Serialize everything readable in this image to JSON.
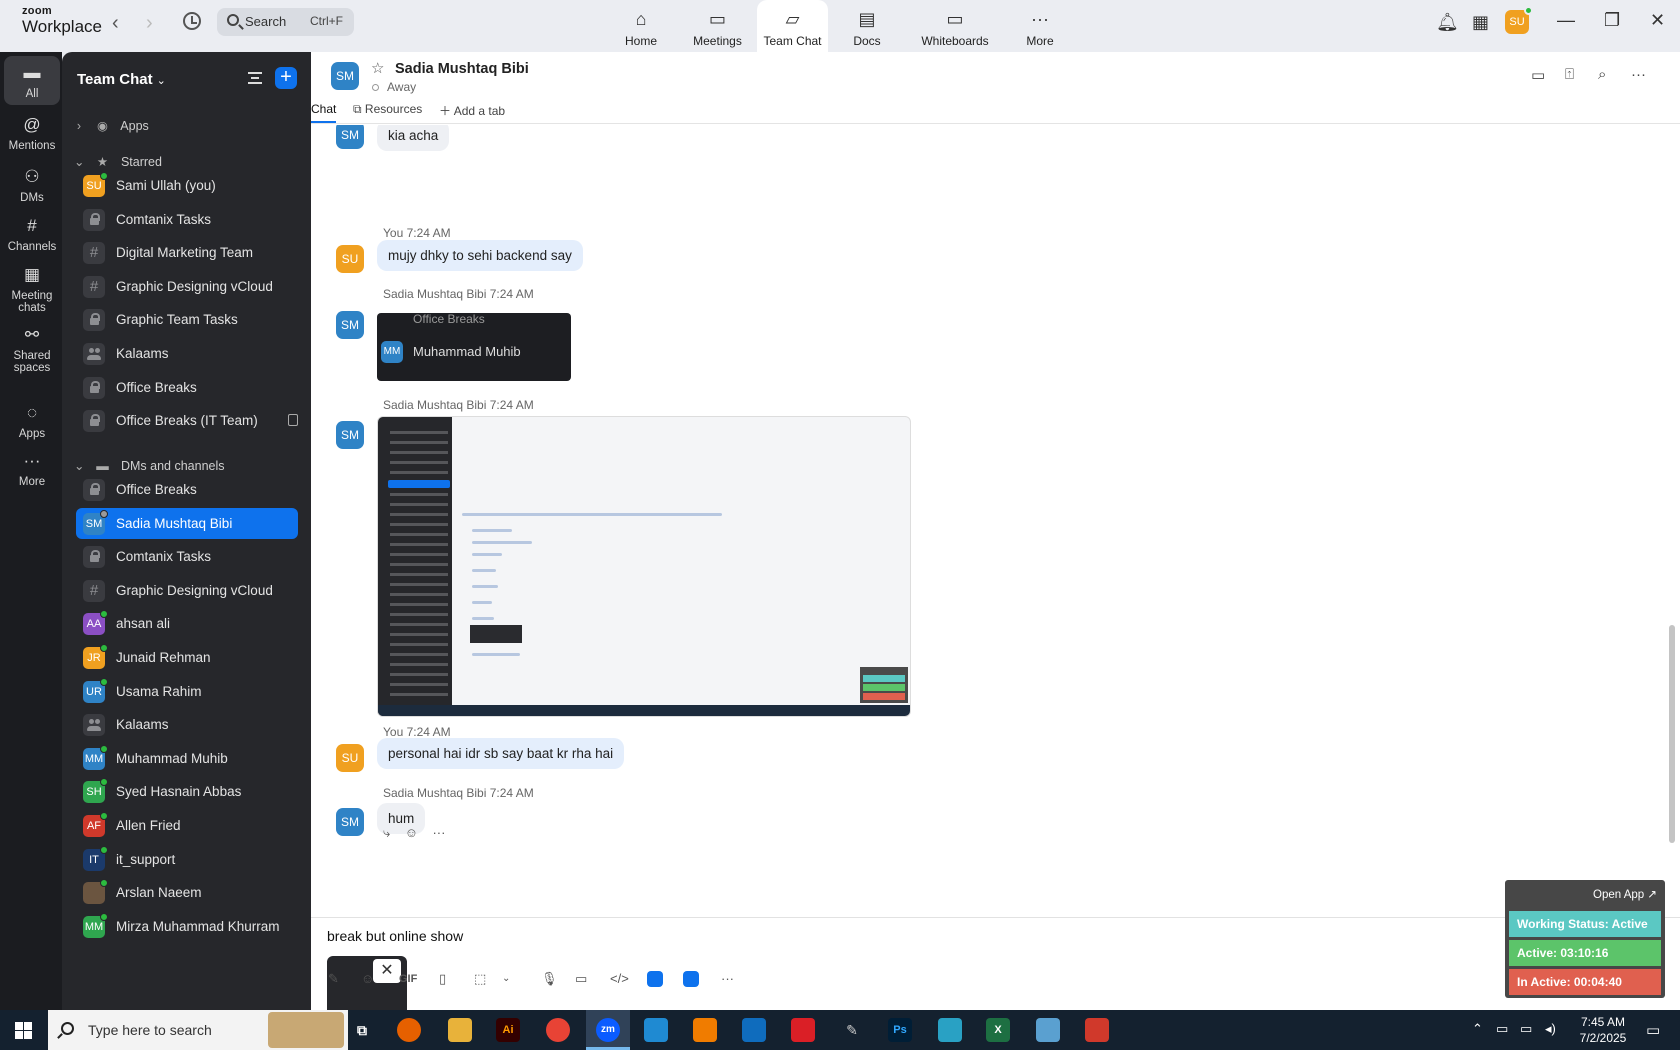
{
  "app": {
    "logo_line1": "zoom",
    "logo_line2": "Workplace",
    "search_label": "Search",
    "search_shortcut": "Ctrl+F",
    "avatar_initials": "SU"
  },
  "topnav": [
    {
      "label": "Home",
      "icon": "home-icon",
      "glyph": "⌂"
    },
    {
      "label": "Meetings",
      "icon": "video-icon",
      "glyph": "▭"
    },
    {
      "label": "Team Chat",
      "icon": "chat-icon",
      "glyph": "💬"
    },
    {
      "label": "Docs",
      "icon": "doc-icon",
      "glyph": "▤"
    },
    {
      "label": "Whiteboards",
      "icon": "whiteboard-icon",
      "glyph": "▭"
    },
    {
      "label": "More",
      "icon": "more-icon",
      "glyph": "···"
    }
  ],
  "rail": [
    {
      "label": "All",
      "icon": "chat-icon",
      "glyph": "▬"
    },
    {
      "label": "Mentions",
      "icon": "at-icon",
      "glyph": "@"
    },
    {
      "label": "DMs",
      "icon": "people-icon",
      "glyph": "👥"
    },
    {
      "label": "Channels",
      "icon": "hash-icon",
      "glyph": "#"
    },
    {
      "label": "Meeting chats",
      "icon": "calendar-icon",
      "glyph": "▦"
    },
    {
      "label": "Shared spaces",
      "icon": "share-icon",
      "glyph": "⚯"
    },
    {
      "label": "Apps",
      "icon": "apps-icon",
      "glyph": "💬"
    },
    {
      "label": "More",
      "icon": "more-icon",
      "glyph": "···"
    }
  ],
  "sidebar": {
    "title": "Team Chat",
    "sections": {
      "apps": "Apps",
      "starred": "Starred",
      "dms": "DMs and channels"
    },
    "starred": [
      {
        "label": "Sami Ullah (you)",
        "type": "avatar",
        "initials": "SU",
        "color": "#f0a020",
        "status": "online"
      },
      {
        "label": "Comtanix Tasks",
        "type": "lock"
      },
      {
        "label": "Digital Marketing Team",
        "type": "hash"
      },
      {
        "label": "Graphic Designing vCloud",
        "type": "hash"
      },
      {
        "label": "Graphic Team Tasks",
        "type": "lock"
      },
      {
        "label": "Kalaams",
        "type": "group"
      },
      {
        "label": "Office Breaks",
        "type": "lock"
      },
      {
        "label": "Office Breaks (IT Team)",
        "type": "lock"
      }
    ],
    "dms": [
      {
        "label": "Office Breaks",
        "type": "lock"
      },
      {
        "label": "Sadia Mushtaq Bibi",
        "type": "avatar",
        "initials": "SM",
        "color": "#2f83c6",
        "status": "away",
        "selected": true
      },
      {
        "label": "Comtanix Tasks",
        "type": "lock"
      },
      {
        "label": "Graphic Designing vCloud",
        "type": "hash"
      },
      {
        "label": "ahsan ali",
        "type": "avatar",
        "initials": "AA",
        "color": "#8b4fc4",
        "status": "online"
      },
      {
        "label": "Junaid Rehman",
        "type": "avatar",
        "initials": "JR",
        "color": "#f0a020",
        "status": "online"
      },
      {
        "label": "Usama Rahim",
        "type": "avatar",
        "initials": "UR",
        "color": "#2f83c6",
        "status": "online"
      },
      {
        "label": "Kalaams",
        "type": "group"
      },
      {
        "label": "Muhammad Muhib",
        "type": "avatar",
        "initials": "MM",
        "color": "#2f83c6",
        "status": "online"
      },
      {
        "label": "Syed Hasnain Abbas",
        "type": "avatar",
        "initials": "SH",
        "color": "#2fa64f",
        "status": "online"
      },
      {
        "label": "Allen Fried",
        "type": "avatar",
        "initials": "AF",
        "color": "#d0392b",
        "status": "online"
      },
      {
        "label": "it_support",
        "type": "avatar",
        "initials": "IT",
        "color": "#1b3a6b",
        "status": "online"
      },
      {
        "label": "Arslan Naeem",
        "type": "avatar",
        "initials": "",
        "color": "#6b5540",
        "status": "online"
      },
      {
        "label": "Mirza Muhammad Khurram",
        "type": "avatar",
        "initials": "MM",
        "color": "#2fa64f",
        "status": "online"
      }
    ]
  },
  "channel": {
    "avatar": "SM",
    "name": "Sadia Mushtaq Bibi",
    "status": "Away",
    "tabs": [
      "Chat",
      "Resources",
      "Add a tab"
    ]
  },
  "messages": {
    "m0_text": "kia acha",
    "m1_meta": "You 7:24 AM",
    "m1_text": "mujy dhky to sehi backend say",
    "m2_meta": "Sadia Mushtaq Bibi 7:24 AM",
    "m2_img_line1": "Office Breaks",
    "m2_img_avatar": "MM",
    "m2_img_line2": "Muhammad Muhib",
    "m3_meta": "Sadia Mushtaq Bibi 7:24 AM",
    "m4_meta": "You 7:24 AM",
    "m4_text": "personal hai idr sb say baat kr rha hai",
    "m5_meta": "Sadia Mushtaq Bibi 7:24 AM",
    "m5_text": "hum"
  },
  "composer": {
    "text": "break but online show",
    "gif_label": "GIF"
  },
  "work_status": {
    "open_app": "Open App ↗",
    "status": "Working Status: Active",
    "active": "Active: 03:10:16",
    "inactive": "In Active: 00:04:40",
    "colors": {
      "status": "#5bc8c3",
      "active": "#5cc46a",
      "inactive": "#e0604f"
    }
  },
  "taskbar": {
    "search_placeholder": "Type here to search",
    "time": "7:45 AM",
    "date": "7/2/2025"
  }
}
